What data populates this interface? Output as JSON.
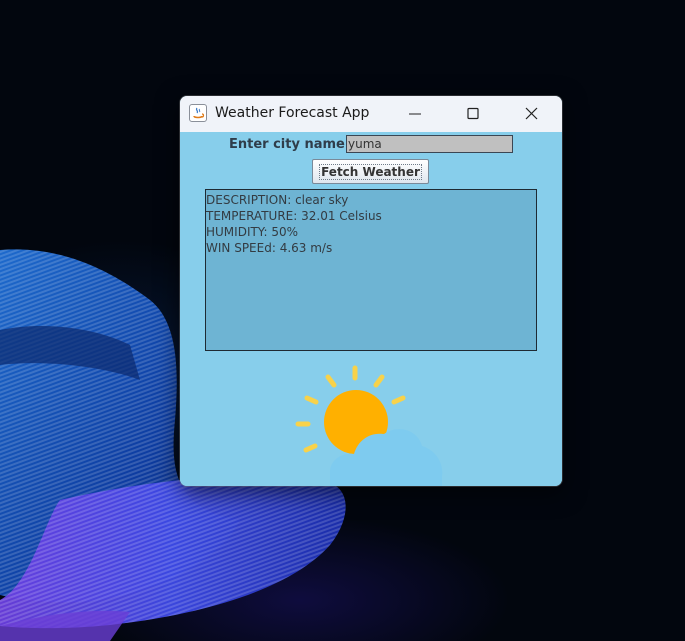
{
  "window": {
    "title": "Weather Forecast App"
  },
  "form": {
    "city_label": "Enter city name:",
    "city_value": "yuma",
    "fetch_button_label": "Fetch Weather"
  },
  "weather": {
    "lines": [
      "DESCRIPTION: clear sky",
      "TEMPERATURE: 32.01 Celsius",
      "HUMIDITY: 50%",
      "WIN SPEEd: 4.63 m/s"
    ],
    "icon": "sun-behind-cloud-icon"
  },
  "colors": {
    "window_background": "#87ceeb",
    "text_area_background": "#6eb4d3",
    "input_background": "#c0c0c0",
    "sun": "#ffb000",
    "sun_rays": "#f8d24a",
    "cloud": "#7ecbef"
  }
}
